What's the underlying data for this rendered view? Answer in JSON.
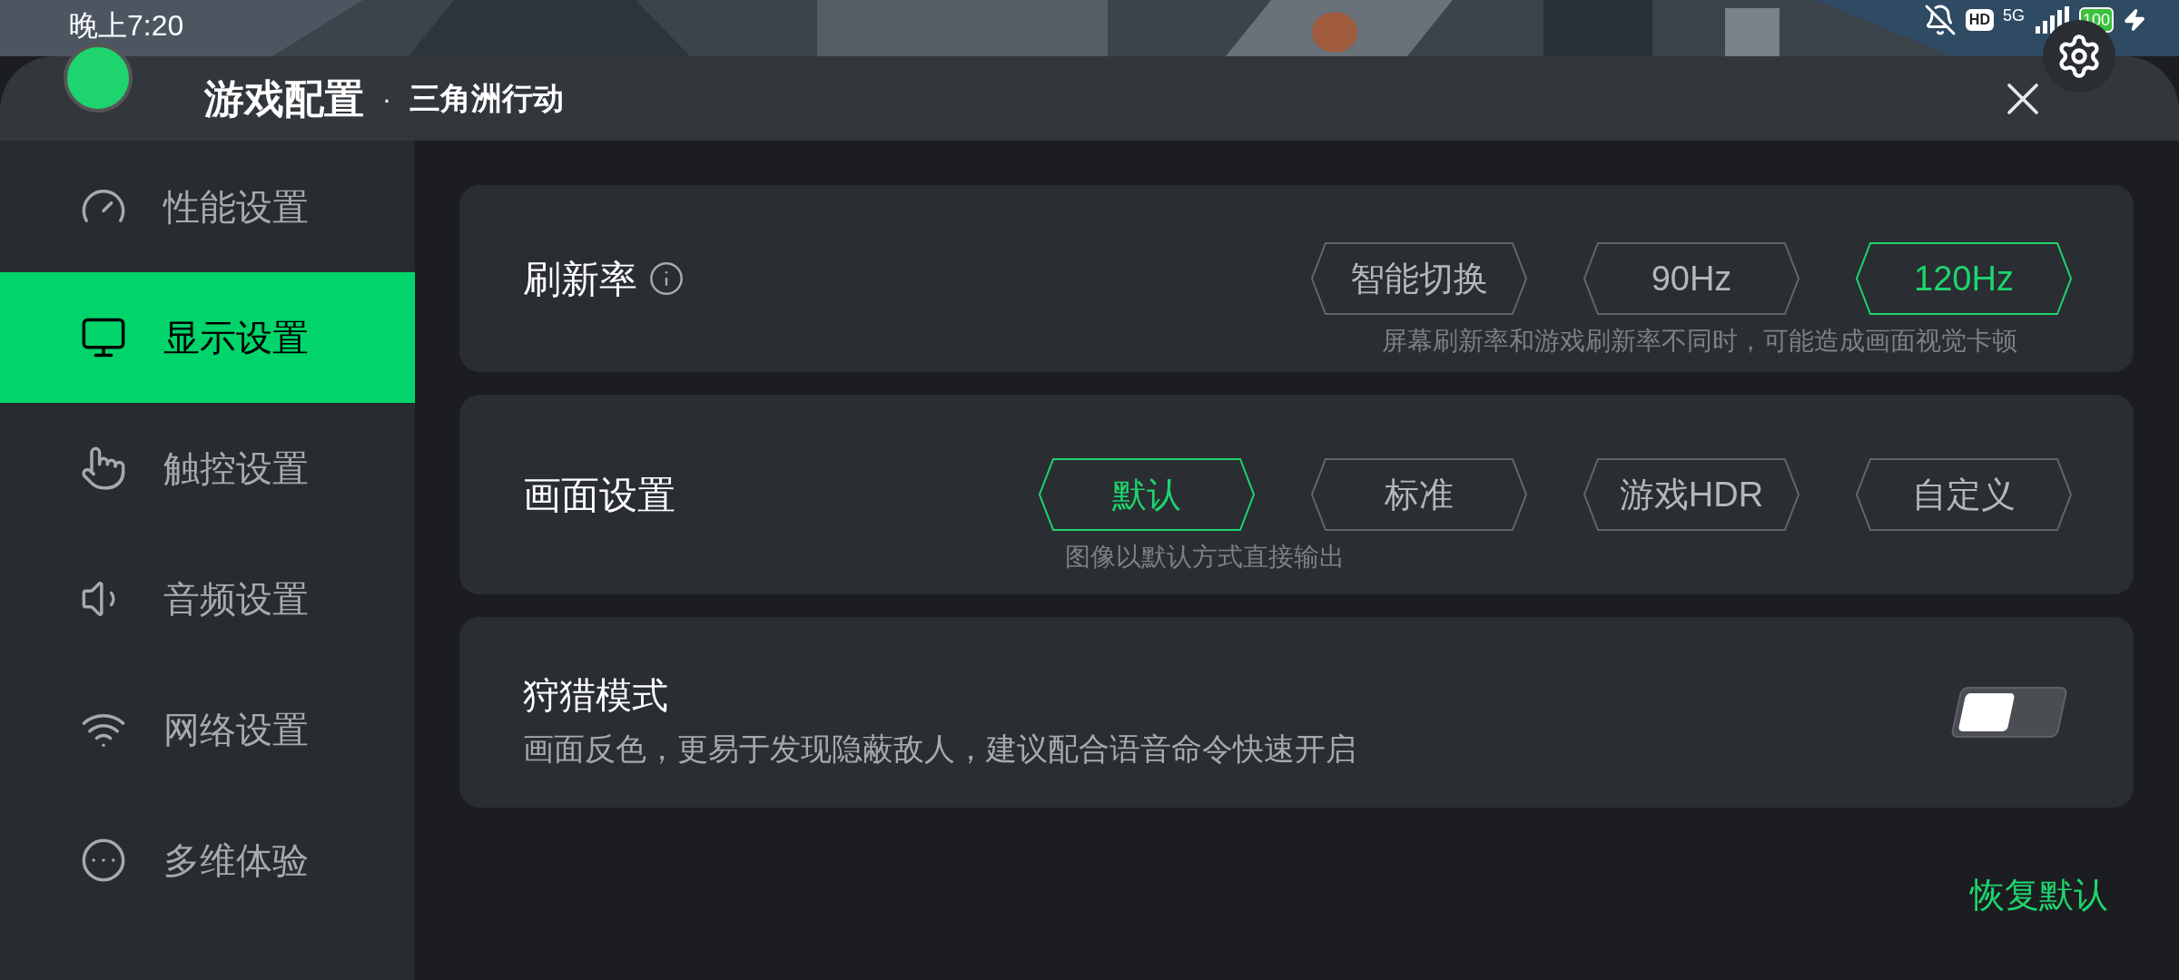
{
  "status_bar": {
    "time": "晚上7:20",
    "hd_badge": "HD",
    "network": "5G",
    "battery": "100"
  },
  "header": {
    "title": "游戏配置",
    "separator": "·",
    "game": "三角洲行动"
  },
  "sidebar": {
    "items": [
      {
        "label": "性能设置",
        "kind": "gauge",
        "selected": false
      },
      {
        "label": "显示设置",
        "kind": "monitor",
        "selected": true
      },
      {
        "label": "触控设置",
        "kind": "hand",
        "selected": false
      },
      {
        "label": "音频设置",
        "kind": "speaker",
        "selected": false
      },
      {
        "label": "网络设置",
        "kind": "wifi",
        "selected": false
      },
      {
        "label": "多维体验",
        "kind": "more",
        "selected": false
      }
    ]
  },
  "refresh_rate": {
    "label": "刷新率",
    "options": [
      {
        "label": "智能切换",
        "selected": false
      },
      {
        "label": "90Hz",
        "selected": false
      },
      {
        "label": "120Hz",
        "selected": true
      }
    ],
    "hint": "屏幕刷新率和游戏刷新率不同时，可能造成画面视觉卡顿"
  },
  "picture_mode": {
    "label": "画面设置",
    "options": [
      {
        "label": "默认",
        "selected": true
      },
      {
        "label": "标准",
        "selected": false
      },
      {
        "label": "游戏HDR",
        "selected": false
      },
      {
        "label": "自定义",
        "selected": false
      }
    ],
    "hint": "图像以默认方式直接输出"
  },
  "hunting_mode": {
    "label": "狩猎模式",
    "description": "画面反色，更易于发现隐蔽敌人，建议配合语音命令快速开启",
    "on": false
  },
  "reset_button": "恢复默认"
}
